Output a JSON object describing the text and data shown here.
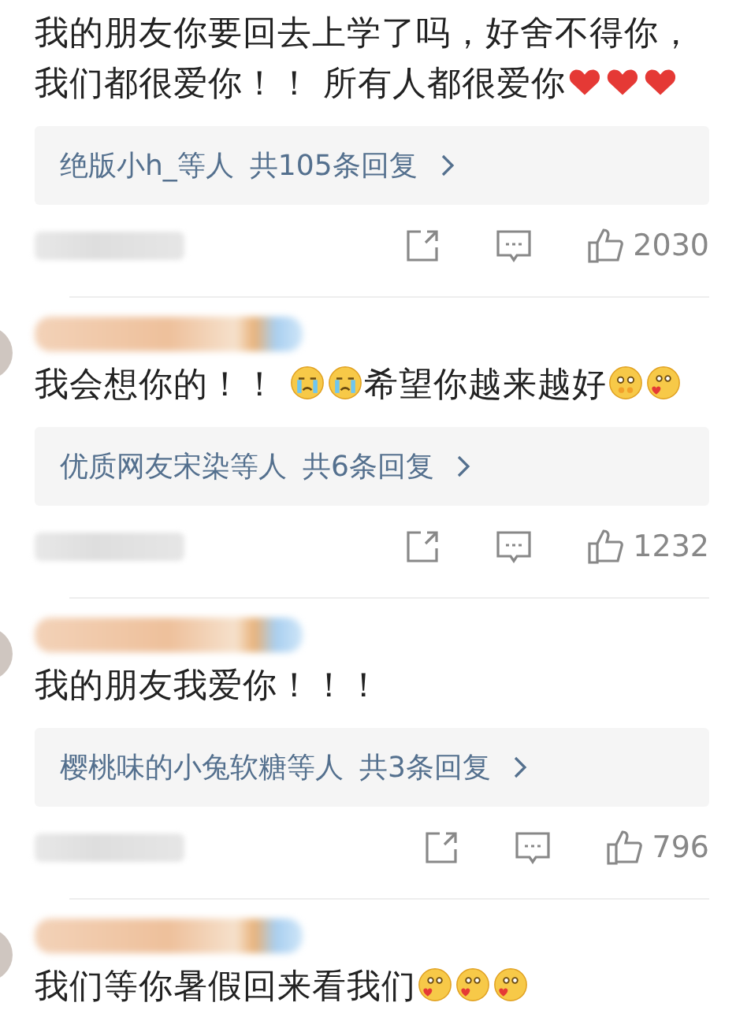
{
  "comments": [
    {
      "name_visible": false,
      "content": [
        {
          "kind": "text",
          "text": "我的朋友你要回去上学了吗，好舍不得你，我们都很爱你！！ 所有人都很爱你"
        },
        {
          "kind": "heart"
        },
        {
          "kind": "heart"
        },
        {
          "kind": "heart"
        }
      ],
      "replies": {
        "names": "绝版小h_等人",
        "count": "共105条回复"
      },
      "likes": "2030"
    },
    {
      "name_visible": true,
      "content": [
        {
          "kind": "text",
          "text": "我会想你的！！ "
        },
        {
          "kind": "crying"
        },
        {
          "kind": "crying"
        },
        {
          "kind": "text",
          "text": "希望你越来越好"
        },
        {
          "kind": "shy"
        },
        {
          "kind": "kiss"
        }
      ],
      "replies": {
        "names": "优质网友宋染等人",
        "count": "共6条回复"
      },
      "likes": "1232"
    },
    {
      "name_visible": true,
      "content": [
        {
          "kind": "text",
          "text": "我的朋友我爱你！！！"
        }
      ],
      "replies": {
        "names": "樱桃味的小兔软糖等人",
        "count": "共3条回复"
      },
      "likes": "796"
    },
    {
      "name_visible": true,
      "content": [
        {
          "kind": "text",
          "text": "我们等你暑假回来看我们"
        },
        {
          "kind": "kiss"
        },
        {
          "kind": "kiss"
        },
        {
          "kind": "kiss"
        }
      ]
    }
  ]
}
